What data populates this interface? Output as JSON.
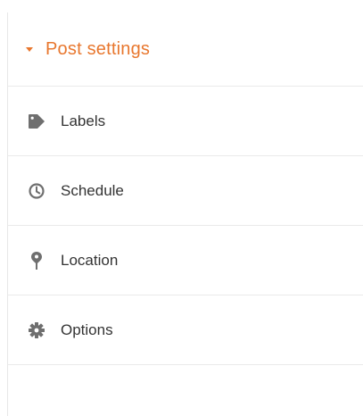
{
  "panel": {
    "title": "Post settings",
    "items": [
      {
        "label": "Labels",
        "icon": "tag-icon"
      },
      {
        "label": "Schedule",
        "icon": "clock-icon"
      },
      {
        "label": "Location",
        "icon": "map-pin-icon"
      },
      {
        "label": "Options",
        "icon": "gear-icon"
      }
    ]
  },
  "colors": {
    "accent": "#e8772e",
    "icon": "#6f6f6f",
    "text": "#333333",
    "divider": "#eaeaea"
  }
}
